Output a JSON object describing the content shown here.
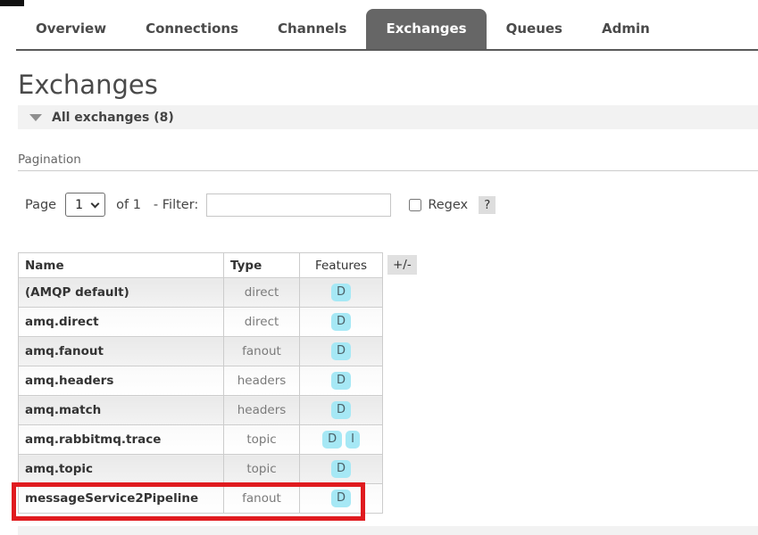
{
  "nav": {
    "tabs": [
      {
        "label": "Overview",
        "active": false
      },
      {
        "label": "Connections",
        "active": false
      },
      {
        "label": "Channels",
        "active": false
      },
      {
        "label": "Exchanges",
        "active": true
      },
      {
        "label": "Queues",
        "active": false
      },
      {
        "label": "Admin",
        "active": false
      }
    ]
  },
  "page": {
    "title": "Exchanges"
  },
  "section": {
    "all_exchanges_label": "All exchanges (8)",
    "collapse_icon": "triangle-down"
  },
  "pagination": {
    "heading": "Pagination",
    "page_label": "Page",
    "page_value": "1",
    "page_select_icon": "chevron-down",
    "of_label": "of 1",
    "filter_label": "- Filter:",
    "filter_value": "",
    "regex_label": "Regex",
    "regex_checked": false,
    "help_label": "?"
  },
  "table": {
    "headers": [
      "Name",
      "Type",
      "Features"
    ],
    "toggle_button": "+/-",
    "rows": [
      {
        "name": "(AMQP default)",
        "type": "direct",
        "features": [
          "D"
        ],
        "highlighted": false
      },
      {
        "name": "amq.direct",
        "type": "direct",
        "features": [
          "D"
        ],
        "highlighted": false
      },
      {
        "name": "amq.fanout",
        "type": "fanout",
        "features": [
          "D"
        ],
        "highlighted": false
      },
      {
        "name": "amq.headers",
        "type": "headers",
        "features": [
          "D"
        ],
        "highlighted": false
      },
      {
        "name": "amq.match",
        "type": "headers",
        "features": [
          "D"
        ],
        "highlighted": false
      },
      {
        "name": "amq.rabbitmq.trace",
        "type": "topic",
        "features": [
          "D",
          "I"
        ],
        "highlighted": false
      },
      {
        "name": "amq.topic",
        "type": "topic",
        "features": [
          "D"
        ],
        "highlighted": false
      },
      {
        "name": "messageService2Pipeline",
        "type": "fanout",
        "features": [
          "D"
        ],
        "highlighted": true
      }
    ]
  },
  "colors": {
    "tab_active_bg": "#666666",
    "nav_border": "#595959",
    "section_bar_bg": "#f2f2f2",
    "badge_bg": "#a6e8f5",
    "annotation_red": "#e01b1f"
  }
}
